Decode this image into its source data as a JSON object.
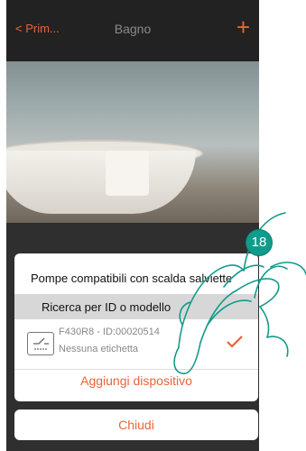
{
  "nav": {
    "back_label": "Prim...",
    "title": "Bagno",
    "add_symbol": "+"
  },
  "dialog": {
    "title": "Pompe compatibili con scalda salviette",
    "search_label": "Ricerca per ID o modello",
    "device": {
      "code": "F430R8 - ID:00020514",
      "label": "Nessuna etichetta",
      "icon": "actuator-icon"
    },
    "add_label": "Aggiungi dispositivo",
    "close_label": "Chiudi"
  },
  "step_badge": "18",
  "colors": {
    "accent": "#e8643a",
    "teal": "#119b8c"
  }
}
